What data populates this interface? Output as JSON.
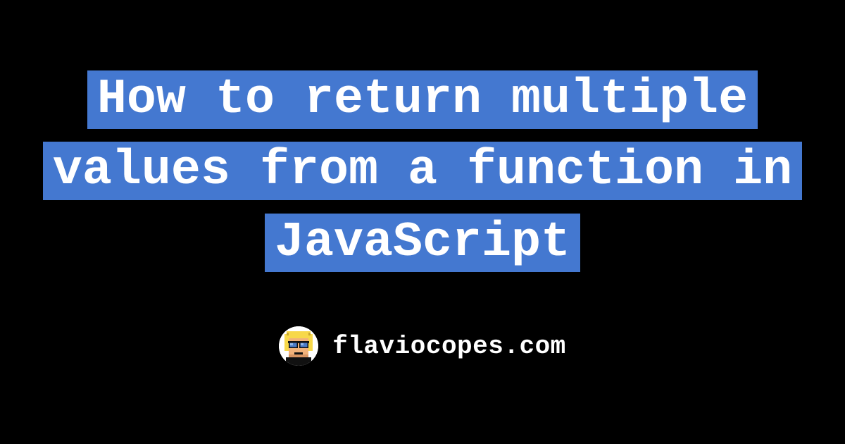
{
  "title": "How to return multiple values from a function in JavaScript",
  "site_name": "flaviocopes.com",
  "colors": {
    "background": "#000000",
    "highlight": "#4478D0",
    "text": "#ffffff"
  },
  "avatar": {
    "description": "pixel-art-face",
    "hair_color": "#F7D84A",
    "skin_color": "#F1B27A",
    "glasses_color": "#4A7BC8"
  }
}
